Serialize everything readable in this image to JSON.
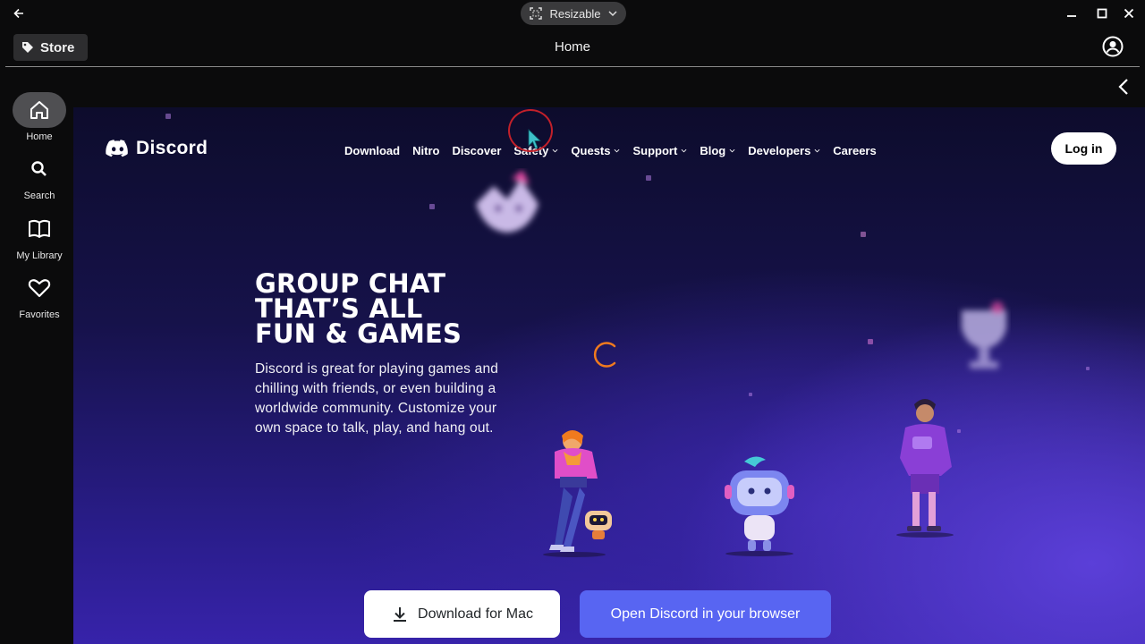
{
  "window": {
    "mode_label": "Resizable"
  },
  "app_header": {
    "store_label": "Store",
    "title": "Home"
  },
  "sidebar": {
    "items": [
      {
        "label": "Home",
        "icon": "home-icon",
        "active": true
      },
      {
        "label": "Search",
        "icon": "search-icon",
        "active": false
      },
      {
        "label": "My Library",
        "icon": "book-icon",
        "active": false
      },
      {
        "label": "Favorites",
        "icon": "heart-icon",
        "active": false
      }
    ]
  },
  "site": {
    "brand": "Discord",
    "nav": [
      {
        "label": "Download",
        "dropdown": false
      },
      {
        "label": "Nitro",
        "dropdown": false
      },
      {
        "label": "Discover",
        "dropdown": false
      },
      {
        "label": "Safety",
        "dropdown": true
      },
      {
        "label": "Quests",
        "dropdown": true
      },
      {
        "label": "Support",
        "dropdown": true
      },
      {
        "label": "Blog",
        "dropdown": true
      },
      {
        "label": "Developers",
        "dropdown": true
      },
      {
        "label": "Careers",
        "dropdown": false
      }
    ],
    "login_label": "Log in",
    "hero": {
      "title_lines": [
        "GROUP CHAT",
        "THAT’S ALL",
        "FUN & GAMES"
      ],
      "body": "Discord is great for playing games and chilling with friends, or even building a worldwide community. Customize your own space to talk, play, and hang out."
    },
    "buttons": {
      "download": "Download for Mac",
      "open_browser": "Open Discord in your browser"
    }
  },
  "colors": {
    "blurple": "#5865f2",
    "spinner": "#f07a1e",
    "cursor_ring": "#c2202a",
    "cursor": "#3ec1c9"
  }
}
